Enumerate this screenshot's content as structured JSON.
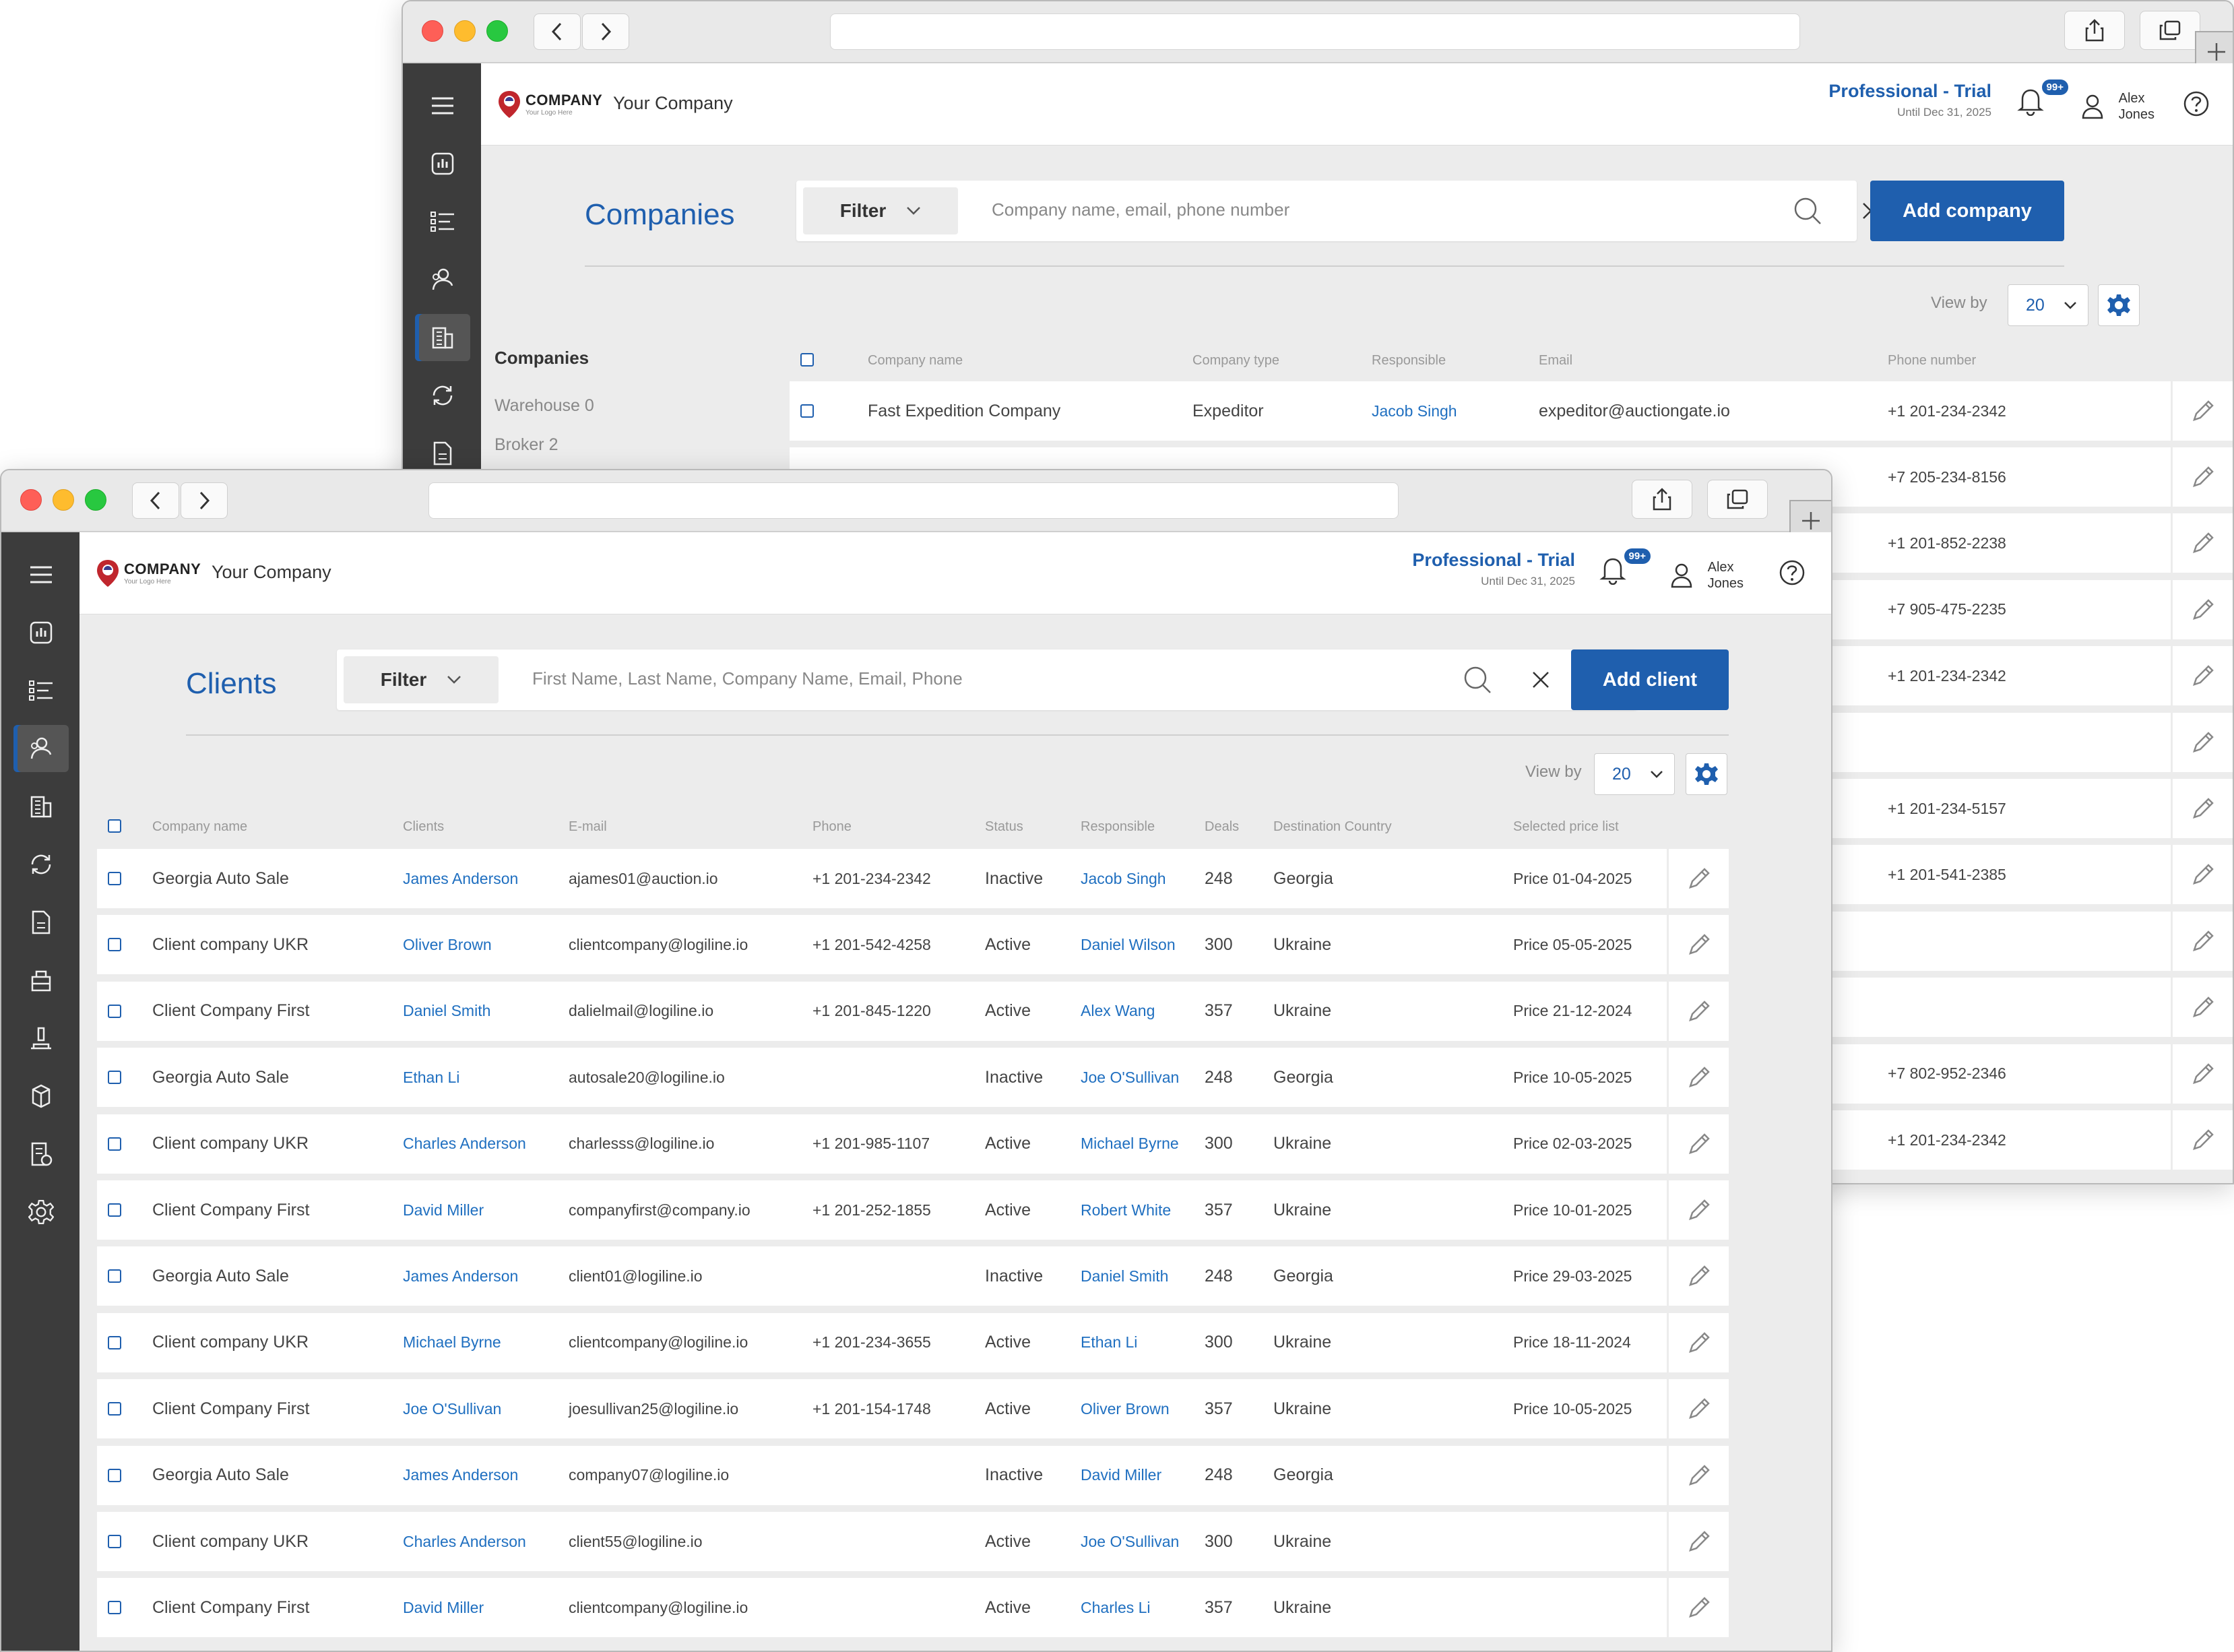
{
  "back": {
    "topbar": {
      "company_name": "Your Company",
      "plan_title": "Professional - Trial",
      "plan_sub": "Until Dec 31, 2025",
      "badge": "99+",
      "user_first": "Alex",
      "user_last": "Jones",
      "logo_main": "COMPANY",
      "logo_sub": "Your Logo Here"
    },
    "page_title": "Companies",
    "filter_label": "Filter",
    "search_placeholder": "Company name, email, phone number",
    "add_button": "Add company",
    "viewby_label": "View by",
    "viewby_value": "20",
    "sub_nav": {
      "heading": "Companies",
      "items": [
        "Warehouse 0",
        "Broker 2"
      ]
    },
    "columns": [
      "Company name",
      "Company type",
      "Responsible",
      "Email",
      "Phone number"
    ],
    "first_row": {
      "name": "Fast Expedition Company",
      "type": "Expeditor",
      "responsible": "Jacob Singh",
      "email": "expeditor@auctiongate.io",
      "phone": "+1 201-234-2342"
    },
    "phones": [
      "+7 205-234-8156",
      "+1 201-852-2238",
      "+7 905-475-2235",
      "+1 201-234-2342",
      "",
      "+1 201-234-5157",
      "+1 201-541-2385",
      "",
      "",
      "+7 802-952-2346",
      "+1 201-234-2342"
    ]
  },
  "front": {
    "topbar": {
      "company_name": "Your Company",
      "plan_title": "Professional - Trial",
      "plan_sub": "Until Dec 31, 2025",
      "badge": "99+",
      "user_first": "Alex",
      "user_last": "Jones",
      "logo_main": "COMPANY",
      "logo_sub": "Your Logo Here"
    },
    "page_title": "Clients",
    "filter_label": "Filter",
    "search_placeholder": "First Name, Last Name, Company Name, Email, Phone",
    "add_button": "Add client",
    "viewby_label": "View by",
    "viewby_value": "20",
    "columns": [
      "Company name",
      "Clients",
      "E-mail",
      "Phone",
      "Status",
      "Responsible",
      "Deals",
      "Destination Country",
      "Selected price list"
    ],
    "rows": [
      {
        "company": "Georgia Auto Sale",
        "client": "James Anderson",
        "email": "ajames01@auction.io",
        "phone": "+1 201-234-2342",
        "status": "Inactive",
        "responsible": "Jacob Singh",
        "deals": "248",
        "country": "Georgia",
        "price": "Price 01-04-2025"
      },
      {
        "company": "Client company UKR",
        "client": "Oliver Brown",
        "email": "clientcompany@logiline.io",
        "phone": "+1 201-542-4258",
        "status": "Active",
        "responsible": "Daniel Wilson",
        "deals": "300",
        "country": "Ukraine",
        "price": "Price 05-05-2025"
      },
      {
        "company": "Client Company First",
        "client": "Daniel Smith",
        "email": "dalielmail@logiline.io",
        "phone": "+1 201-845-1220",
        "status": "Active",
        "responsible": "Alex Wang",
        "deals": "357",
        "country": "Ukraine",
        "price": "Price 21-12-2024"
      },
      {
        "company": "Georgia Auto Sale",
        "client": "Ethan Li",
        "email": "autosale20@logiline.io",
        "phone": "",
        "status": "Inactive",
        "responsible": "Joe O'Sullivan",
        "deals": "248",
        "country": "Georgia",
        "price": "Price 10-05-2025"
      },
      {
        "company": "Client company UKR",
        "client": "Charles Anderson",
        "email": "charlesss@logiline.io",
        "phone": "+1 201-985-1107",
        "status": "Active",
        "responsible": "Michael Byrne",
        "deals": "300",
        "country": "Ukraine",
        "price": "Price 02-03-2025"
      },
      {
        "company": "Client Company First",
        "client": "David Miller",
        "email": "companyfirst@company.io",
        "phone": "+1 201-252-1855",
        "status": "Active",
        "responsible": "Robert White",
        "deals": "357",
        "country": "Ukraine",
        "price": "Price 10-01-2025"
      },
      {
        "company": "Georgia Auto Sale",
        "client": "James Anderson",
        "email": "client01@logiline.io",
        "phone": "",
        "status": "Inactive",
        "responsible": "Daniel Smith",
        "deals": "248",
        "country": "Georgia",
        "price": "Price 29-03-2025"
      },
      {
        "company": "Client company UKR",
        "client": "Michael Byrne",
        "email": "clientcompany@logiline.io",
        "phone": "+1 201-234-3655",
        "status": "Active",
        "responsible": "Ethan Li",
        "deals": "300",
        "country": "Ukraine",
        "price": "Price 18-11-2024"
      },
      {
        "company": "Client Company First",
        "client": "Joe O'Sullivan",
        "email": "joesullivan25@logiline.io",
        "phone": "+1 201-154-1748",
        "status": "Active",
        "responsible": "Oliver Brown",
        "deals": "357",
        "country": "Ukraine",
        "price": "Price 10-05-2025"
      },
      {
        "company": "Georgia Auto Sale",
        "client": "James Anderson",
        "email": "company07@logiline.io",
        "phone": "",
        "status": "Inactive",
        "responsible": "David Miller",
        "deals": "248",
        "country": "Georgia",
        "price": ""
      },
      {
        "company": "Client company UKR",
        "client": "Charles Anderson",
        "email": "client55@logiline.io",
        "phone": "",
        "status": "Active",
        "responsible": "Joe O'Sullivan",
        "deals": "300",
        "country": "Ukraine",
        "price": ""
      },
      {
        "company": "Client Company First",
        "client": "David Miller",
        "email": "clientcompany@logiline.io",
        "phone": "",
        "status": "Active",
        "responsible": "Charles Li",
        "deals": "357",
        "country": "Ukraine",
        "price": ""
      }
    ]
  },
  "icons": {
    "sidebar": [
      "menu-icon",
      "dashboard-icon",
      "tasks-icon",
      "clients-icon",
      "companies-icon",
      "sync-icon",
      "document-icon",
      "warehouse-icon",
      "auction-icon",
      "shipping-icon",
      "invoice-icon",
      "settings-icon"
    ]
  },
  "colors": {
    "accent": "#1f5fae",
    "link": "#1f6fc0",
    "sidebar": "#3c3c3c",
    "background": "#ececec"
  }
}
